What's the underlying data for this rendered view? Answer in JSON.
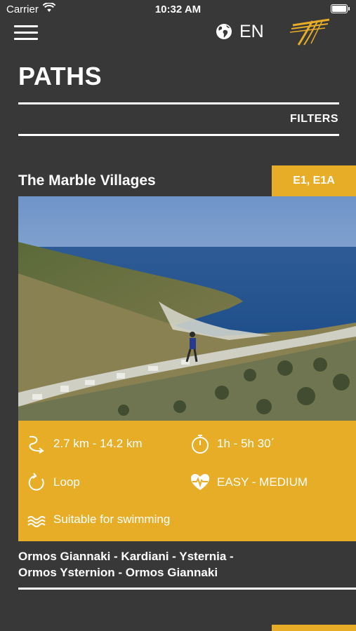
{
  "status_bar": {
    "carrier": "Carrier",
    "time": "10:32 AM"
  },
  "header": {
    "language": "EN",
    "menu_icon": "hamburger-menu-icon",
    "logo_icon": "brand-logo"
  },
  "page": {
    "title": "PATHS",
    "filters_label": "FILTERS"
  },
  "card": {
    "title": "The Marble Villages",
    "route_badge": "E1, E1A",
    "distance": "2.7 km - 14.2 km",
    "duration": "1h - 5h 30΄",
    "type": "Loop",
    "difficulty": "EASY - MEDIUM",
    "feature": "Suitable for swimming",
    "route_line1": "Ormos Giannaki - Kardiani - Ysternia -",
    "route_line2": "Ormos Ysternion - Ormos Giannaki"
  },
  "colors": {
    "background": "#383838",
    "accent": "#e8ad26",
    "text": "#ffffff"
  }
}
